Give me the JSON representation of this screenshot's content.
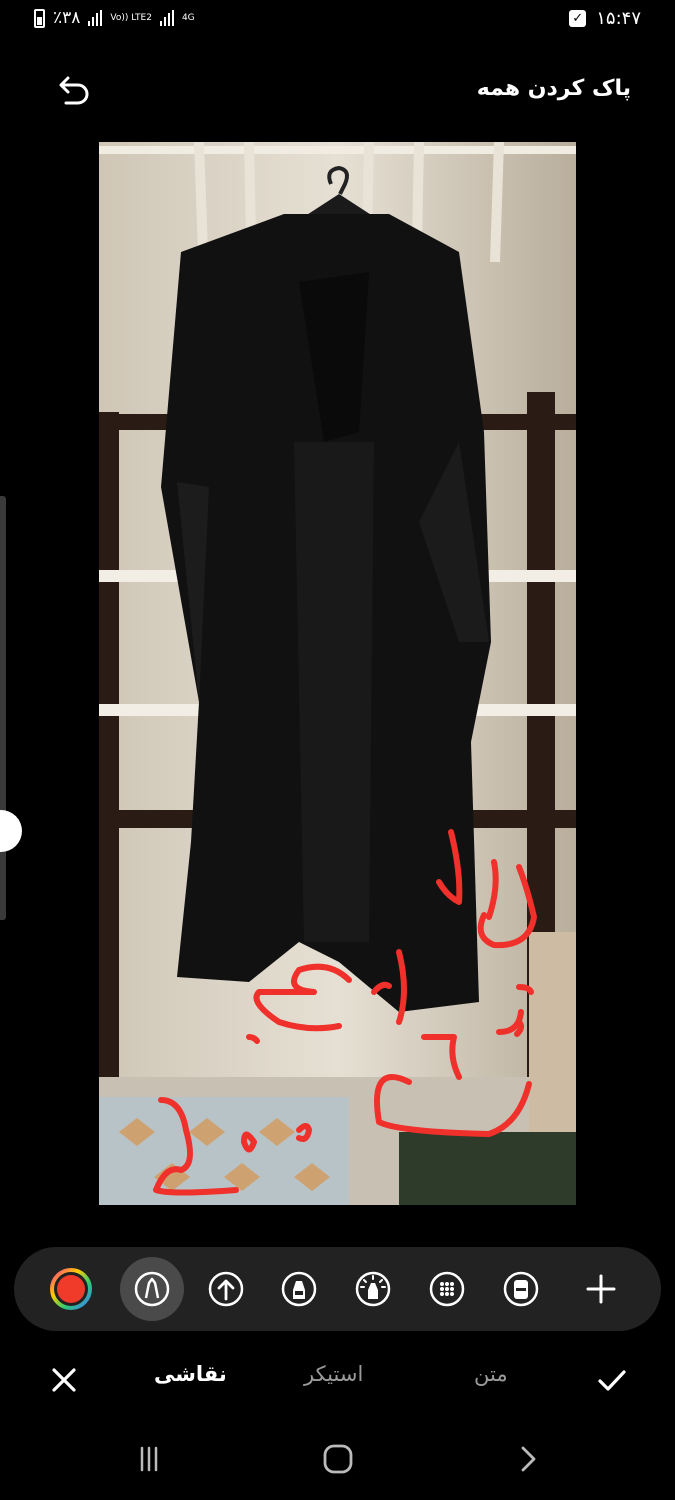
{
  "status_bar": {
    "battery_text": "٪۳۸",
    "network_type": "Vo)) LTE2",
    "network_gen": "4G",
    "time": "۱۵:۴۷"
  },
  "header": {
    "undo_icon": "undo-icon",
    "clear_all_label": "پاک کردن همه"
  },
  "photo": {
    "subject": "black-abaya-on-hanger",
    "handwritten_lines": [
      "سایز ۲۰۲",
      "قیمت",
      "۲۰۰"
    ],
    "ink_color": "#f0302a"
  },
  "brush_size": {
    "level": 0.79
  },
  "toolbar": {
    "tools": [
      {
        "name": "color-picker",
        "icon": "color-wheel-icon",
        "active": false
      },
      {
        "name": "pen",
        "icon": "pen-icon",
        "active": true
      },
      {
        "name": "arrow",
        "icon": "arrow-up-icon",
        "active": false
      },
      {
        "name": "marker",
        "icon": "marker-icon",
        "active": false
      },
      {
        "name": "glow",
        "icon": "glow-icon",
        "active": false
      },
      {
        "name": "mosaic",
        "icon": "mosaic-icon",
        "active": false
      },
      {
        "name": "eraser",
        "icon": "eraser-icon",
        "active": false
      },
      {
        "name": "add",
        "icon": "plus-icon",
        "active": false
      }
    ]
  },
  "bottom_tabs": {
    "cancel_icon": "close-icon",
    "draw_label": "نقاشی",
    "sticker_label": "استیکر",
    "text_label": "متن",
    "done_icon": "check-icon"
  },
  "nav_bar": {
    "recents_icon": "recents-icon",
    "home_icon": "home-icon",
    "back_icon": "back-icon"
  }
}
